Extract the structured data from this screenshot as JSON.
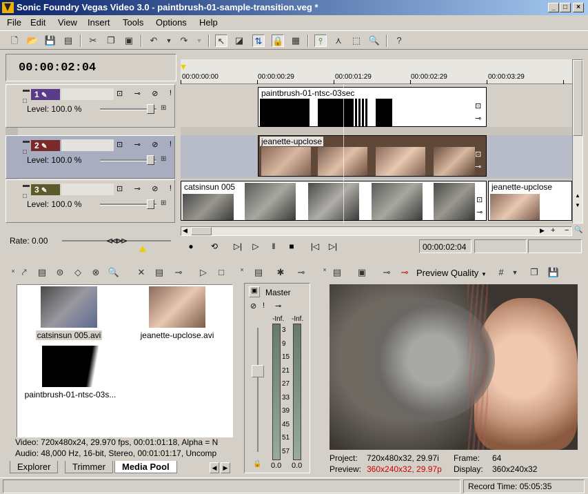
{
  "window": {
    "title": "Sonic Foundry Vegas Video 3.0 - paintbrush-01-sample-transition.veg *",
    "min": "_",
    "max": "□",
    "close": "×"
  },
  "menu": [
    "File",
    "Edit",
    "View",
    "Insert",
    "Tools",
    "Options",
    "Help"
  ],
  "timecode": "00:00:02:04",
  "ruler": [
    "00:00:00:00",
    "00:00:00:29",
    "00:00:01:29",
    "00:00:02:29",
    "00:00:03:29"
  ],
  "tracks": [
    {
      "num": "1",
      "color": "#5a3a8a",
      "level": "Level: 100.0 %"
    },
    {
      "num": "2",
      "color": "#7a2a2a",
      "level": "Level: 100.0 %"
    },
    {
      "num": "3",
      "color": "#5a5a2a",
      "level": "Level: 100.0 %"
    }
  ],
  "events": {
    "e1": "paintbrush-01-ntsc-03sec",
    "e2": "jeanette-upclose",
    "e3": "catsinsun 005",
    "e4": "jeanette-upclose"
  },
  "rate": "Rate: 0.00",
  "transport_time": "00:00:02:04",
  "media": {
    "items": [
      {
        "label": "catsinsun 005.avi"
      },
      {
        "label": "jeanette-upclose.avi"
      },
      {
        "label": "paintbrush-01-ntsc-03s..."
      }
    ],
    "video_info": "Video: 720x480x24, 29.970 fps, 00:01:01:18, Alpha = N",
    "audio_info": "Audio: 48,000 Hz, 16-bit, Stereo, 00:01:01:17, Uncomp",
    "tabs": [
      "Explorer",
      "Trimmer",
      "Media Pool"
    ]
  },
  "mixer": {
    "title": "Master",
    "inf_l": "-Inf.",
    "inf_r": "-Inf.",
    "scale": [
      "3",
      "9",
      "15",
      "21",
      "27",
      "33",
      "39",
      "45",
      "51",
      "57"
    ],
    "val_l": "0.0",
    "val_r": "0.0"
  },
  "preview": {
    "quality": "Preview Quality",
    "project_label": "Project:",
    "project_val": "720x480x32, 29.97i",
    "preview_label": "Preview:",
    "preview_val": "360x240x32, 29.97p",
    "frame_label": "Frame:",
    "frame_val": "64",
    "display_label": "Display:",
    "display_val": "360x240x32",
    "preview_color": "#cc0000"
  },
  "status": {
    "record_time": "Record Time: 05:05:35"
  }
}
